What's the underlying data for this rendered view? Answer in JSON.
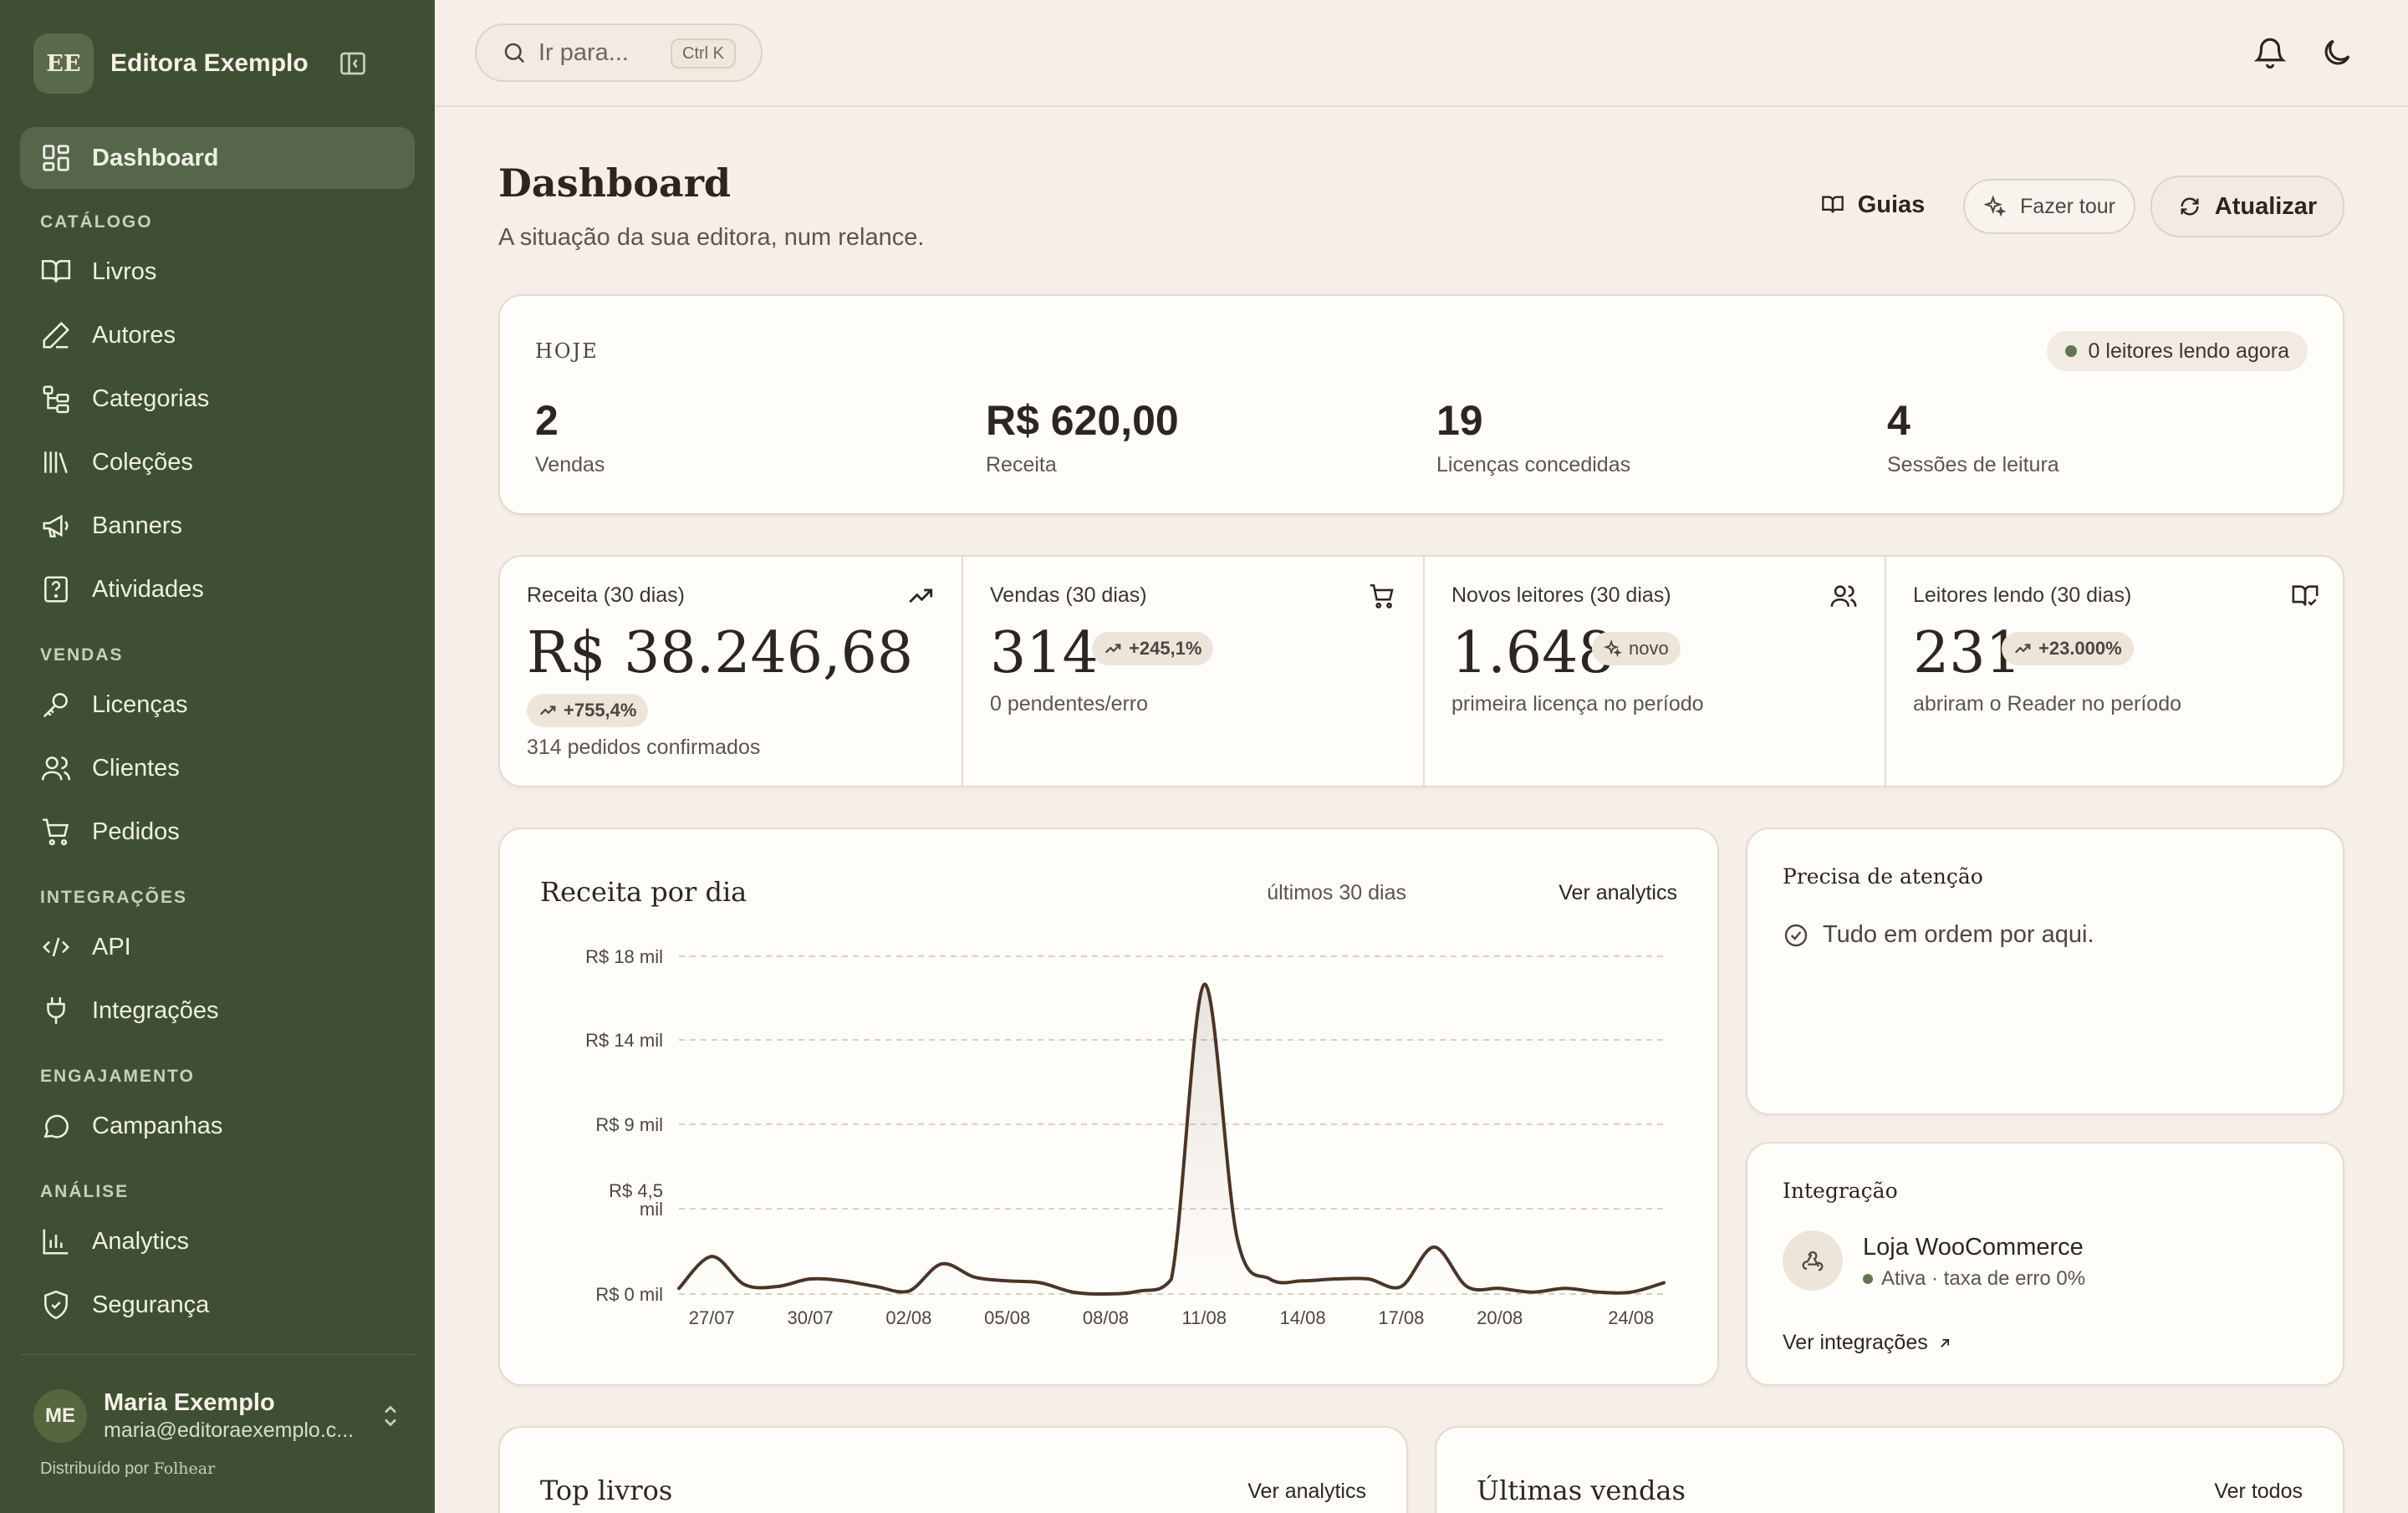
{
  "brand": {
    "logo_text": "EE",
    "name": "Editora Exemplo"
  },
  "nav": {
    "dashboard": "Dashboard",
    "sections": {
      "catalog": "CATÁLOGO",
      "sales": "VENDAS",
      "integrations": "INTEGRAÇÕES",
      "engagement": "ENGAJAMENTO",
      "analysis": "ANÁLISE"
    },
    "items": {
      "livros": "Livros",
      "autores": "Autores",
      "categorias": "Categorias",
      "colecoes": "Coleções",
      "banners": "Banners",
      "atividades": "Atividades",
      "licencas": "Licenças",
      "clientes": "Clientes",
      "pedidos": "Pedidos",
      "api": "API",
      "integracoes": "Integrações",
      "campanhas": "Campanhas",
      "analytics": "Analytics",
      "seguranca": "Segurança"
    }
  },
  "user": {
    "initials": "ME",
    "name": "Maria Exemplo",
    "email": "maria@editoraexemplo.c..."
  },
  "powered": {
    "prefix": "Distribuído por",
    "brand": "Folhear"
  },
  "search": {
    "placeholder": "Ir para...",
    "shortcut": "Ctrl K"
  },
  "header": {
    "title": "Dashboard",
    "subtitle": "A situação da sua editora, num relance.",
    "guides": "Guias",
    "tour": "Fazer tour",
    "refresh": "Atualizar"
  },
  "today": {
    "label": "HOJE",
    "live": "0 leitores lendo agora",
    "stats": [
      {
        "value": "2",
        "label": "Vendas"
      },
      {
        "value": "R$ 620,00",
        "label": "Receita"
      },
      {
        "value": "19",
        "label": "Licenças concedidas"
      },
      {
        "value": "4",
        "label": "Sessões de leitura"
      }
    ]
  },
  "metrics": [
    {
      "label": "Receita (30 dias)",
      "value": "R$ 38.246,68",
      "pill": "+755,4%",
      "sub": "314 pedidos confirmados",
      "icon": "trending-up-icon"
    },
    {
      "label": "Vendas (30 dias)",
      "value": "314",
      "pill": "+245,1%",
      "sub": "0 pendentes/erro",
      "icon": "cart-icon"
    },
    {
      "label": "Novos leitores (30 dias)",
      "value": "1.648",
      "pill": "novo",
      "sub": "primeira licença no período",
      "icon": "users-icon"
    },
    {
      "label": "Leitores lendo (30 dias)",
      "value": "231",
      "pill": "+23.000%",
      "sub": "abriram o Reader no período",
      "icon": "book-open-icon"
    }
  ],
  "chart_card": {
    "title": "Receita por dia",
    "range": "últimos 30 dias",
    "link": "Ver analytics"
  },
  "chart_data": {
    "type": "area",
    "title": "Receita por dia",
    "y_ticks": [
      "R$ 0 mil",
      "R$ 4,5 mil",
      "R$ 9 mil",
      "R$ 14 mil",
      "R$ 18 mil"
    ],
    "x_ticks": [
      "27/07",
      "30/07",
      "02/08",
      "05/08",
      "08/08",
      "11/08",
      "14/08",
      "17/08",
      "20/08",
      "24/08"
    ],
    "ylim": [
      0,
      18000
    ],
    "grid": true,
    "color": "#4a3527",
    "x": [
      "26/07",
      "27/07",
      "28/07",
      "29/07",
      "30/07",
      "31/07",
      "01/08",
      "02/08",
      "03/08",
      "04/08",
      "05/08",
      "06/08",
      "07/08",
      "08/08",
      "09/08",
      "10/08",
      "11/08",
      "12/08",
      "13/08",
      "14/08",
      "15/08",
      "16/08",
      "17/08",
      "18/08",
      "19/08",
      "20/08",
      "21/08",
      "22/08",
      "23/08",
      "24/08",
      "25/08"
    ],
    "values": [
      300,
      2000,
      500,
      400,
      800,
      700,
      400,
      150,
      1600,
      900,
      700,
      600,
      100,
      0,
      150,
      800,
      16500,
      3000,
      800,
      700,
      800,
      800,
      400,
      2500,
      400,
      300,
      100,
      300,
      100,
      100,
      600
    ]
  },
  "attention": {
    "title": "Precisa de atenção",
    "message": "Tudo em ordem por aqui."
  },
  "integration": {
    "title": "Integração",
    "name": "Loja WooCommerce",
    "status": "Ativa · taxa de erro 0%",
    "link": "Ver integrações"
  },
  "top_books": {
    "title": "Top livros",
    "link": "Ver analytics"
  },
  "recent_sales": {
    "title": "Últimas vendas",
    "link": "Ver todos"
  }
}
